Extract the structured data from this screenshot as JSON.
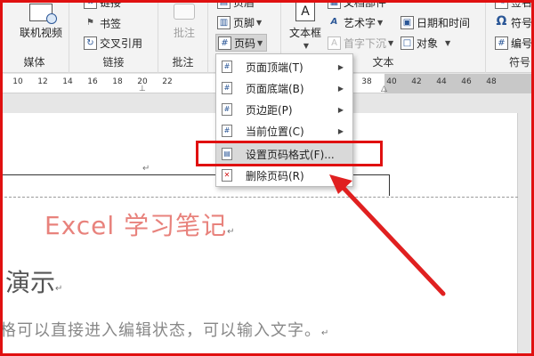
{
  "ribbon": {
    "media": {
      "online_video_label": "联机视频",
      "group_label": "媒体"
    },
    "links": {
      "top_partial_label": "链接",
      "bookmark_label": "书签",
      "cross_ref_label": "交叉引用",
      "group_label": "链接"
    },
    "comments": {
      "comment_label": "批注",
      "group_label": "批注"
    },
    "header_footer": {
      "top_partial_label": "页眉",
      "footer_label": "页脚",
      "page_number_label": "页码"
    },
    "text": {
      "textbox_label": "文本框",
      "top_partial_label": "文档部件",
      "wordart_label": "艺术字",
      "dropcap_label": "首字下沉",
      "datetime_label": "日期和时间",
      "object_label": "对象",
      "group_label": "文本"
    },
    "symbols": {
      "top_partial_label": "签名行",
      "symbol_label": "符号",
      "number_label": "编号",
      "group_label": "符号"
    }
  },
  "ruler": {
    "ticks": [
      "10",
      "12",
      "14",
      "16",
      "18",
      "20",
      "22",
      "38",
      "40",
      "42",
      "44",
      "46",
      "48"
    ]
  },
  "menu": {
    "items": [
      {
        "label": "页面顶端(T)",
        "has_arrow": true
      },
      {
        "label": "页面底端(B)",
        "has_arrow": true
      },
      {
        "label": "页边距(P)",
        "has_arrow": true
      },
      {
        "label": "当前位置(C)",
        "has_arrow": true
      },
      {
        "label": "设置页码格式(F)...",
        "has_arrow": false
      },
      {
        "label": "删除页码(R)",
        "has_arrow": false
      }
    ]
  },
  "document": {
    "title": "Excel 学习笔记",
    "heading": "演示",
    "body": "格可以直接进入编辑状态，可以输入文字。"
  },
  "colors": {
    "annotation_red": "#e01010",
    "title_color": "#e8827c"
  }
}
